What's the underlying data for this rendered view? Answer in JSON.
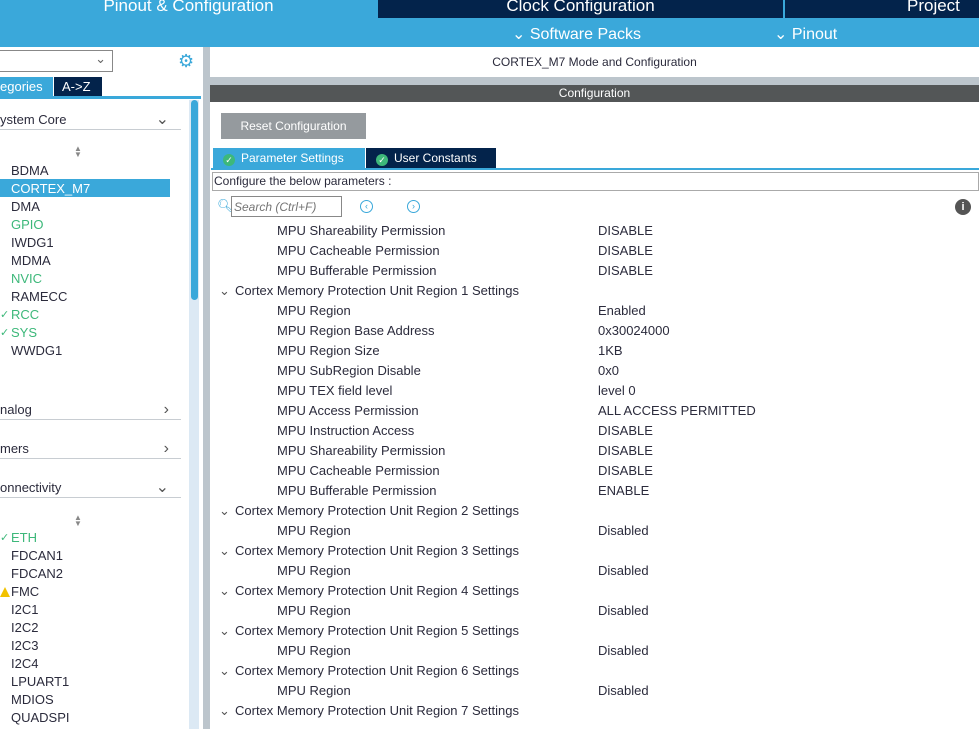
{
  "header": {
    "tabs": [
      "Pinout & Configuration",
      "Clock Configuration",
      "Project"
    ],
    "sub": [
      "Software Packs",
      "Pinout"
    ]
  },
  "sidebar": {
    "tabs": [
      "egories",
      "A->Z"
    ],
    "categories": [
      "ystem Core",
      "nalog",
      "mers",
      "onnectivity"
    ],
    "system_core": [
      {
        "label": "BDMA",
        "s": ""
      },
      {
        "label": "CORTEX_M7",
        "s": "sel"
      },
      {
        "label": "DMA",
        "s": ""
      },
      {
        "label": "GPIO",
        "s": "g"
      },
      {
        "label": "IWDG1",
        "s": ""
      },
      {
        "label": "MDMA",
        "s": ""
      },
      {
        "label": "NVIC",
        "s": "g"
      },
      {
        "label": "RAMECC",
        "s": ""
      },
      {
        "label": "RCC",
        "s": "ok"
      },
      {
        "label": "SYS",
        "s": "ok"
      },
      {
        "label": "WWDG1",
        "s": ""
      }
    ],
    "connectivity": [
      {
        "label": "ETH",
        "s": "ok"
      },
      {
        "label": "FDCAN1",
        "s": ""
      },
      {
        "label": "FDCAN2",
        "s": ""
      },
      {
        "label": "FMC",
        "s": "warn"
      },
      {
        "label": "I2C1",
        "s": ""
      },
      {
        "label": "I2C2",
        "s": ""
      },
      {
        "label": "I2C3",
        "s": ""
      },
      {
        "label": "I2C4",
        "s": ""
      },
      {
        "label": "LPUART1",
        "s": ""
      },
      {
        "label": "MDIOS",
        "s": ""
      },
      {
        "label": "QUADSPI",
        "s": ""
      }
    ]
  },
  "main": {
    "title": "CORTEX_M7 Mode and Configuration",
    "config": "Configuration",
    "reset": "Reset Configuration",
    "tabs": [
      "Parameter Settings",
      "User Constants"
    ],
    "configure_label": "Configure the below parameters :",
    "search_placeholder": "Search (Ctrl+F)",
    "rows": [
      [
        "p",
        "MPU Shareability Permission",
        "DISABLE"
      ],
      [
        "p",
        "MPU Cacheable Permission",
        "DISABLE"
      ],
      [
        "p",
        "MPU Bufferable  Permission",
        "DISABLE"
      ],
      [
        "g",
        "Cortex Memory Protection Unit Region 1 Settings",
        ""
      ],
      [
        "p",
        "MPU Region",
        "Enabled"
      ],
      [
        "p",
        "MPU Region Base Address",
        "0x30024000"
      ],
      [
        "p",
        "MPU Region Size",
        "1KB"
      ],
      [
        "p",
        "MPU SubRegion Disable",
        "0x0"
      ],
      [
        "p",
        "MPU TEX field level",
        "level 0"
      ],
      [
        "p",
        "MPU Access Permission",
        "ALL ACCESS PERMITTED"
      ],
      [
        "p",
        "MPU Instruction Access",
        "DISABLE"
      ],
      [
        "p",
        "MPU Shareability Permission",
        "DISABLE"
      ],
      [
        "p",
        "MPU Cacheable Permission",
        "DISABLE"
      ],
      [
        "p",
        "MPU Bufferable  Permission",
        "ENABLE"
      ],
      [
        "g",
        "Cortex Memory Protection Unit Region 2 Settings",
        ""
      ],
      [
        "p",
        "MPU Region",
        "Disabled"
      ],
      [
        "g",
        "Cortex Memory Protection Unit Region 3 Settings",
        ""
      ],
      [
        "p",
        "MPU Region",
        "Disabled"
      ],
      [
        "g",
        "Cortex Memory Protection Unit Region 4 Settings",
        ""
      ],
      [
        "p",
        "MPU Region",
        "Disabled"
      ],
      [
        "g",
        "Cortex Memory Protection Unit Region 5 Settings",
        ""
      ],
      [
        "p",
        "MPU Region",
        "Disabled"
      ],
      [
        "g",
        "Cortex Memory Protection Unit Region 6 Settings",
        ""
      ],
      [
        "p",
        "MPU Region",
        "Disabled"
      ],
      [
        "g",
        "Cortex Memory Protection Unit Region 7 Settings",
        ""
      ]
    ]
  }
}
